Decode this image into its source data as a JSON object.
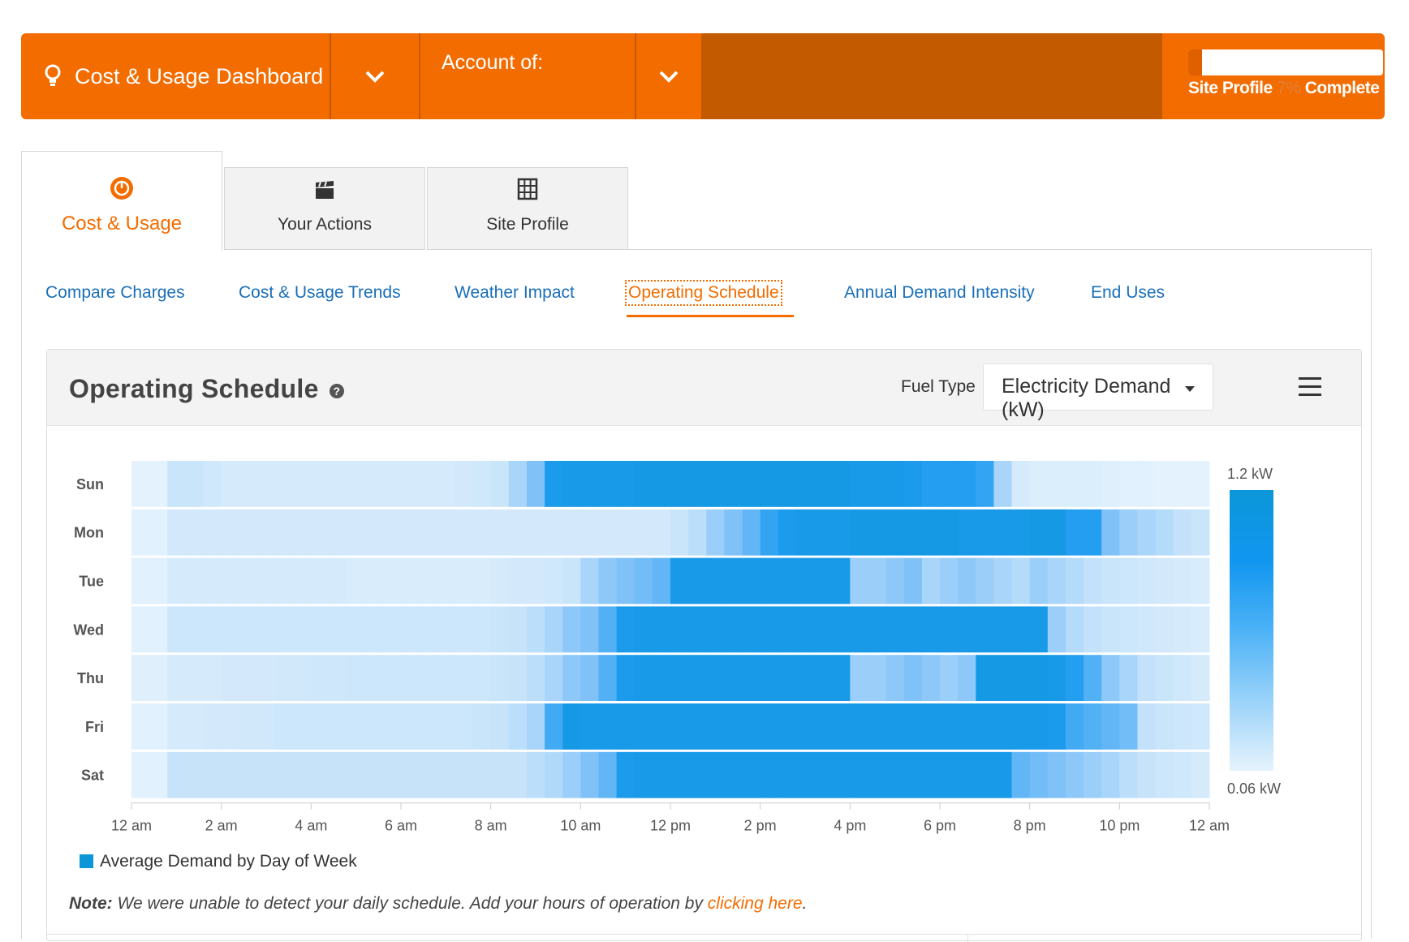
{
  "topbar": {
    "title": "Cost & Usage Dashboard",
    "account_label": "Account of:",
    "site_profile": {
      "prefix": "Site Profile",
      "percent_text": "7%",
      "suffix": "Complete",
      "progress": 0.07
    }
  },
  "tabs": [
    {
      "label": "Cost & Usage",
      "icon": "gauge-icon",
      "active": true
    },
    {
      "label": "Your Actions",
      "icon": "clapperboard-icon",
      "active": false
    },
    {
      "label": "Site Profile",
      "icon": "building-grid-icon",
      "active": false
    }
  ],
  "subnav": [
    {
      "label": "Compare Charges"
    },
    {
      "label": "Cost & Usage Trends"
    },
    {
      "label": "Weather Impact"
    },
    {
      "label": "Operating Schedule",
      "active": true
    },
    {
      "label": "Annual Demand Intensity"
    },
    {
      "label": "End Uses"
    }
  ],
  "card": {
    "title": "Operating Schedule",
    "fuel_label": "Fuel Type",
    "fuel_value": "Electricity Demand (kW)"
  },
  "legend": {
    "label": "Average Demand by Day of Week"
  },
  "note": {
    "bold": "Note:",
    "text": " We were unable to detect your daily schedule. Add your hours of operation by ",
    "link": "clicking here",
    "end": "."
  },
  "colors": {
    "brand": "#f36c00",
    "brand_dark": "#c45a00",
    "link": "#1a6fb8",
    "heat_low": "#e6f3fd",
    "heat_high": "#0b96d8"
  },
  "chart_data": {
    "type": "heatmap",
    "title": "",
    "x_ticks": [
      "12 am",
      "2 am",
      "4 am",
      "6 am",
      "8 am",
      "10 am",
      "12 pm",
      "2 pm",
      "4 pm",
      "6 pm",
      "8 pm",
      "10 pm",
      "12 am"
    ],
    "rows": [
      "Sun",
      "Mon",
      "Tue",
      "Wed",
      "Thu",
      "Fri",
      "Sat"
    ],
    "x_range_hours": [
      0,
      24
    ],
    "color_scale": {
      "min": 0.06,
      "max": 1.2,
      "min_label": "0.06 kW",
      "max_label": "1.2 kW",
      "unit": "kW"
    },
    "legend_entry": "Average Demand by Day of Week",
    "resolution_hours": 0.5,
    "values": {
      "Sun": [
        0.08,
        0.08,
        0.3,
        0.3,
        0.25,
        0.2,
        0.2,
        0.2,
        0.2,
        0.2,
        0.2,
        0.2,
        0.2,
        0.2,
        0.2,
        0.2,
        0.2,
        0.2,
        0.22,
        0.25,
        0.3,
        0.45,
        0.6,
        0.95,
        1.0,
        1.0,
        1.0,
        1.0,
        1.05,
        1.05,
        1.05,
        1.05,
        1.05,
        1.05,
        1.05,
        1.05,
        1.05,
        1.05,
        1.05,
        1.05,
        1.0,
        1.0,
        1.0,
        0.95,
        0.9,
        0.9,
        0.9,
        0.85,
        0.45,
        0.2,
        0.15,
        0.15,
        0.15,
        0.15,
        0.12,
        0.1,
        0.1,
        0.08,
        0.08,
        0.08
      ],
      "Mon": [
        0.1,
        0.1,
        0.22,
        0.22,
        0.22,
        0.22,
        0.22,
        0.22,
        0.22,
        0.22,
        0.22,
        0.22,
        0.22,
        0.22,
        0.22,
        0.22,
        0.22,
        0.22,
        0.22,
        0.22,
        0.22,
        0.22,
        0.22,
        0.22,
        0.22,
        0.22,
        0.22,
        0.22,
        0.22,
        0.22,
        0.3,
        0.38,
        0.5,
        0.6,
        0.7,
        0.85,
        0.95,
        1.0,
        1.0,
        1.0,
        1.05,
        1.05,
        1.05,
        1.05,
        1.05,
        1.05,
        1.0,
        1.0,
        1.0,
        1.0,
        1.05,
        1.05,
        0.9,
        0.9,
        0.6,
        0.5,
        0.45,
        0.4,
        0.35,
        0.3
      ],
      "Tue": [
        0.1,
        0.1,
        0.2,
        0.2,
        0.2,
        0.2,
        0.2,
        0.2,
        0.2,
        0.2,
        0.2,
        0.2,
        0.18,
        0.18,
        0.18,
        0.18,
        0.18,
        0.18,
        0.18,
        0.18,
        0.2,
        0.22,
        0.22,
        0.25,
        0.3,
        0.45,
        0.55,
        0.6,
        0.65,
        0.7,
        1.0,
        1.0,
        1.0,
        1.0,
        1.0,
        1.0,
        1.0,
        1.0,
        1.0,
        1.0,
        0.5,
        0.5,
        0.55,
        0.6,
        0.45,
        0.5,
        0.55,
        0.5,
        0.45,
        0.4,
        0.5,
        0.45,
        0.4,
        0.35,
        0.3,
        0.28,
        0.25,
        0.22,
        0.2,
        0.18
      ],
      "Wed": [
        0.1,
        0.1,
        0.28,
        0.28,
        0.28,
        0.28,
        0.28,
        0.28,
        0.28,
        0.28,
        0.28,
        0.28,
        0.28,
        0.28,
        0.28,
        0.28,
        0.28,
        0.28,
        0.28,
        0.28,
        0.3,
        0.32,
        0.38,
        0.45,
        0.55,
        0.6,
        0.75,
        0.95,
        1.0,
        1.0,
        1.0,
        1.0,
        1.0,
        1.0,
        1.0,
        1.0,
        1.0,
        1.0,
        1.0,
        1.0,
        1.0,
        1.0,
        1.0,
        1.0,
        1.0,
        1.0,
        1.0,
        1.0,
        1.0,
        1.0,
        1.0,
        0.5,
        0.4,
        0.35,
        0.3,
        0.28,
        0.25,
        0.22,
        0.2,
        0.18
      ],
      "Thu": [
        0.12,
        0.12,
        0.2,
        0.2,
        0.2,
        0.22,
        0.22,
        0.22,
        0.24,
        0.24,
        0.26,
        0.26,
        0.28,
        0.28,
        0.28,
        0.28,
        0.28,
        0.28,
        0.28,
        0.28,
        0.3,
        0.32,
        0.38,
        0.45,
        0.55,
        0.6,
        0.75,
        0.95,
        1.0,
        1.0,
        1.0,
        1.0,
        1.0,
        1.0,
        1.0,
        1.0,
        1.0,
        1.0,
        1.0,
        1.0,
        0.5,
        0.5,
        0.55,
        0.6,
        0.55,
        0.5,
        0.55,
        1.05,
        1.05,
        1.05,
        1.05,
        1.0,
        0.9,
        0.75,
        0.55,
        0.45,
        0.35,
        0.3,
        0.25,
        0.2
      ],
      "Fri": [
        0.1,
        0.1,
        0.2,
        0.2,
        0.22,
        0.22,
        0.24,
        0.24,
        0.28,
        0.28,
        0.28,
        0.28,
        0.28,
        0.28,
        0.28,
        0.28,
        0.28,
        0.28,
        0.28,
        0.3,
        0.32,
        0.38,
        0.45,
        0.8,
        1.05,
        1.0,
        1.0,
        1.0,
        1.0,
        1.0,
        1.0,
        1.0,
        1.0,
        1.0,
        1.0,
        1.0,
        1.0,
        1.0,
        1.0,
        1.0,
        1.0,
        1.0,
        1.0,
        1.0,
        1.0,
        1.0,
        1.0,
        1.0,
        1.0,
        1.0,
        1.0,
        0.95,
        0.8,
        0.75,
        0.7,
        0.65,
        0.35,
        0.3,
        0.28,
        0.25
      ],
      "Sat": [
        0.1,
        0.1,
        0.32,
        0.32,
        0.32,
        0.32,
        0.32,
        0.32,
        0.32,
        0.32,
        0.32,
        0.32,
        0.32,
        0.32,
        0.32,
        0.32,
        0.32,
        0.32,
        0.32,
        0.32,
        0.32,
        0.32,
        0.38,
        0.42,
        0.5,
        0.6,
        0.7,
        0.95,
        1.0,
        1.0,
        1.0,
        1.0,
        1.0,
        1.0,
        1.0,
        1.0,
        1.0,
        1.0,
        1.0,
        1.0,
        1.0,
        1.0,
        1.0,
        1.0,
        1.0,
        1.0,
        1.0,
        1.0,
        1.0,
        0.7,
        0.65,
        0.6,
        0.55,
        0.5,
        0.45,
        0.38,
        0.32,
        0.28,
        0.25,
        0.2
      ]
    }
  }
}
